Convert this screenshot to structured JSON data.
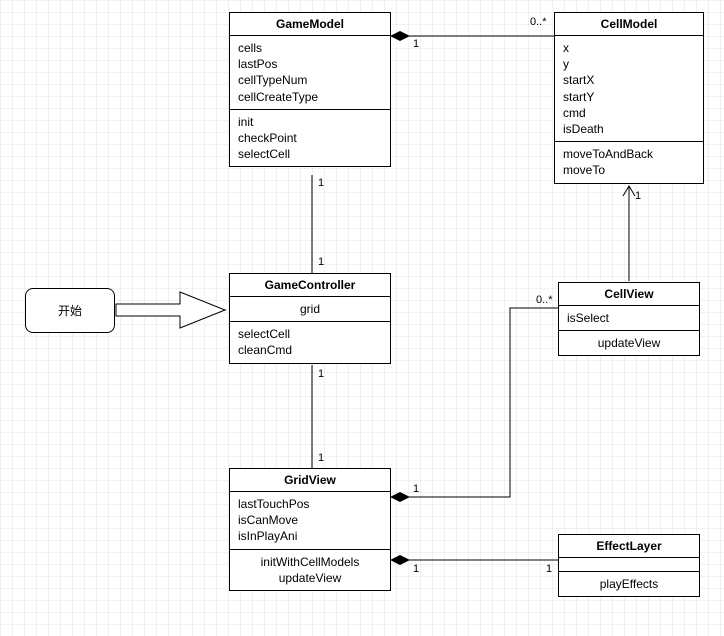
{
  "start": {
    "label": "开始"
  },
  "classes": {
    "gameModel": {
      "name": "GameModel",
      "attrs": [
        "cells",
        "lastPos",
        "cellTypeNum",
        "cellCreateType"
      ],
      "ops": [
        "init",
        "checkPoint",
        "selectCell"
      ]
    },
    "cellModel": {
      "name": "CellModel",
      "attrs": [
        "x",
        "y",
        "startX",
        "startY",
        "cmd",
        "isDeath"
      ],
      "ops": [
        "moveToAndBack",
        "moveTo"
      ]
    },
    "gameController": {
      "name": "GameController",
      "attrs": [
        "grid"
      ],
      "ops": [
        "selectCell",
        "cleanCmd"
      ]
    },
    "cellView": {
      "name": "CellView",
      "attrs": [
        "isSelect"
      ],
      "ops": [
        "updateView"
      ]
    },
    "gridView": {
      "name": "GridView",
      "attrs": [
        "lastTouchPos",
        "isCanMove",
        "isInPlayAni"
      ],
      "ops": [
        "initWithCellModels",
        "updateView"
      ]
    },
    "effectLayer": {
      "name": "EffectLayer",
      "attrs": [],
      "ops": [
        "playEffects"
      ]
    }
  },
  "mult": {
    "gameModelCell_left": "1",
    "gameModelCell_right": "0..*",
    "gameModelController_top": "1",
    "gameModelController_bottom": "1",
    "controllerGrid_top": "1",
    "controllerGrid_bottom": "1",
    "gridCellView_left": "1",
    "gridCellView_right": "0..*",
    "gridEffect_left": "1",
    "gridEffect_right": "1",
    "cellViewCellModel_bottom": "1"
  }
}
